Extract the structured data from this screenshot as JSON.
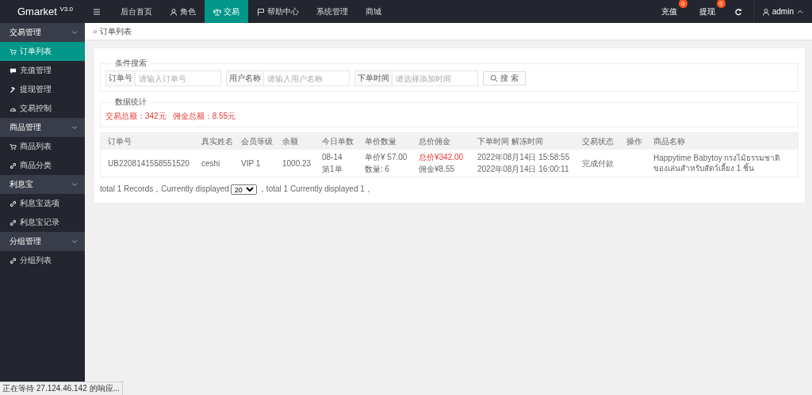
{
  "brand": {
    "name": "Gmarket",
    "version": "V3.0"
  },
  "topnav": [
    {
      "label": "后台首页",
      "selected": false
    },
    {
      "label": "角色",
      "selected": false
    },
    {
      "label": "交易",
      "selected": true
    },
    {
      "label": "帮助中心",
      "selected": false
    },
    {
      "label": "系统管理",
      "selected": false
    },
    {
      "label": "商城",
      "selected": false
    }
  ],
  "topright": {
    "items": [
      {
        "label": "充值",
        "badge": "0"
      },
      {
        "label": "提现",
        "badge": "0"
      }
    ],
    "user": "admin"
  },
  "sidebar": [
    {
      "label": "交易管理",
      "expanded": true,
      "children": [
        {
          "label": "订单列表",
          "selected": true
        },
        {
          "label": "充值管理",
          "selected": false
        },
        {
          "label": "提现管理",
          "selected": false
        },
        {
          "label": "交易控制",
          "selected": false
        }
      ]
    },
    {
      "label": "商品管理",
      "expanded": true,
      "children": [
        {
          "label": "商品列表",
          "selected": false
        },
        {
          "label": "商品分类",
          "selected": false
        }
      ]
    },
    {
      "label": "利息宝",
      "expanded": true,
      "children": [
        {
          "label": "利息宝选项",
          "selected": false
        },
        {
          "label": "利息宝记录",
          "selected": false
        }
      ]
    },
    {
      "label": "分组管理",
      "expanded": true,
      "children": [
        {
          "label": "分组列表",
          "selected": false
        }
      ]
    }
  ],
  "breadcrumb": {
    "sep": "»",
    "label": "订单列表"
  },
  "search": {
    "legend": "条件搜索",
    "fields": [
      {
        "label": "订单号",
        "placeholder": "请输入订单号"
      },
      {
        "label": "用户名称",
        "placeholder": "请输入用户名称"
      },
      {
        "label": "下单时间",
        "placeholder": "请选择添加时间"
      }
    ],
    "button": "搜 索"
  },
  "stats": {
    "legend": "数据统计",
    "items": [
      "交易总额：342元",
      "佣金总额：8.55元"
    ]
  },
  "table": {
    "columns": [
      "订单号",
      "真实姓名",
      "会员等级",
      "余额",
      "今日单数",
      "单价数量",
      "总价佣金",
      "下单时间 解冻时间",
      "交易状态",
      "操作",
      "商品名称"
    ],
    "rows": [
      [
        [
          {
            "text": "UB2208141558551520",
            "emphasis": false
          }
        ],
        [
          {
            "text": "ceshi",
            "emphasis": false
          }
        ],
        [
          {
            "text": "VIP 1",
            "emphasis": false
          }
        ],
        [
          {
            "text": "1000.23",
            "emphasis": false
          }
        ],
        [
          {
            "text": "08-14",
            "emphasis": false
          },
          {
            "text": "第1单",
            "emphasis": false
          }
        ],
        [
          {
            "text": "单价¥ 57.00",
            "emphasis": false
          },
          {
            "text": "数量: 6",
            "emphasis": false
          }
        ],
        [
          {
            "text": "总价¥342.00",
            "emphasis": true
          },
          {
            "text": "佣金¥8.55",
            "emphasis": false
          }
        ],
        [
          {
            "text": "2022年08月14日 15:58:55",
            "emphasis": false
          },
          {
            "text": "2022年08月14日 16:00:11",
            "emphasis": false
          }
        ],
        [
          {
            "text": "完成付款",
            "emphasis": false
          }
        ],
        [],
        [
          {
            "text": "Happytime Babytoy กรงไม้ธรรมชาติของเล่นสำหรับสัตว์เลี้ยง 1 ชิ้น",
            "emphasis": false
          }
        ]
      ]
    ]
  },
  "pager": {
    "before": "total 1 Records，Currently displayed",
    "page_size": "20",
    "after": "，total 1 Currently displayed 1 。"
  },
  "status_bar": "正在等待 27.124.46.142 的响应..."
}
